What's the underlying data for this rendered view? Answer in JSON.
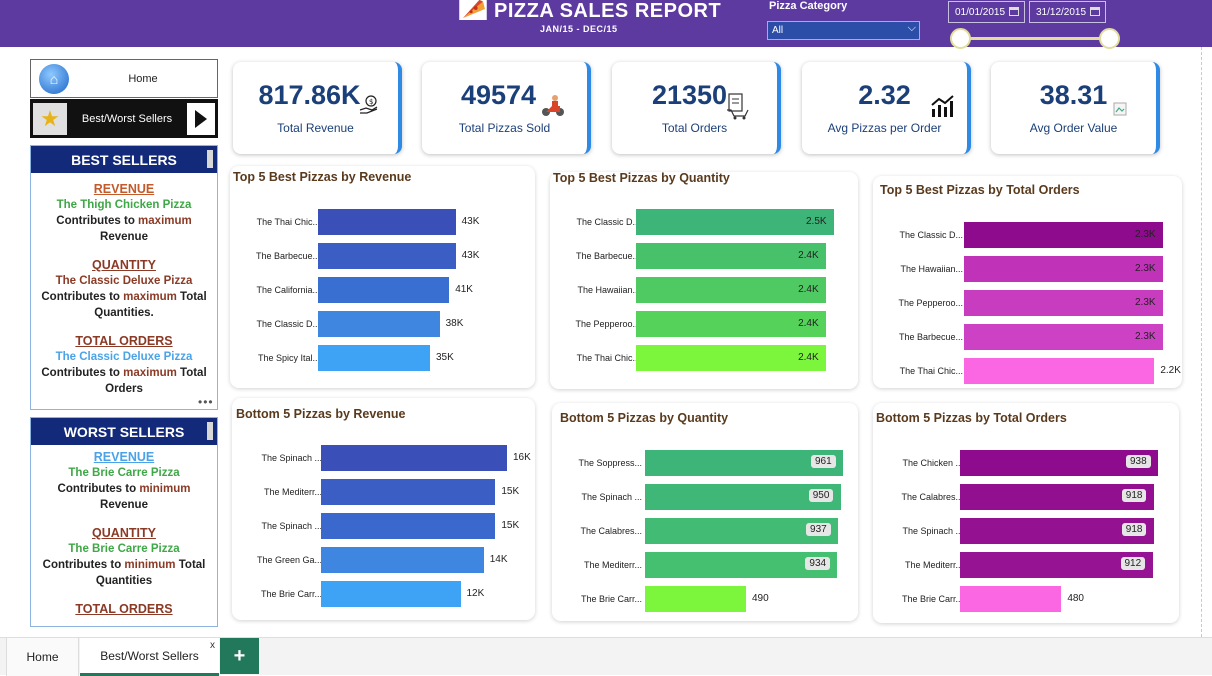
{
  "header": {
    "title": "PIZZA SALES REPORT",
    "subtitle": "JAN/15 - DEC/15",
    "category_label": "Pizza Category",
    "category_value": "All",
    "date_start": "01/01/2015",
    "date_end": "31/12/2015",
    "bg_color": "#5d3aa0"
  },
  "nav": {
    "home_label": "Home",
    "best_worst_label": "Best/Worst Sellers"
  },
  "best_sellers": {
    "heading": "BEST SELLERS",
    "revenue_title": "REVENUE",
    "revenue_pizza": "The Thigh Chicken Pizza",
    "revenue_line1_a": "Contributes to ",
    "revenue_line1_b": "maximum",
    "revenue_line2": "Revenue",
    "quantity_title": "QUANTITY",
    "quantity_pizza": "The Classic Deluxe Pizza",
    "quantity_line1_a": "Contributes to ",
    "quantity_line1_b": "maximum",
    "quantity_line1_c": " Total",
    "quantity_line2": "Quantities.",
    "orders_title": "TOTAL ORDERS",
    "orders_pizza": "The Classic Deluxe Pizza",
    "orders_line1_a": "Contributes to ",
    "orders_line1_b": "maximum",
    "orders_line1_c": " Total",
    "orders_line2": "Orders"
  },
  "worst_sellers": {
    "heading": "WORST SELLERS",
    "revenue_title": "REVENUE",
    "revenue_pizza": "The Brie Carre Pizza",
    "revenue_line1_a": "Contributes to ",
    "revenue_line1_b": "minimum",
    "revenue_line2": "Revenue",
    "quantity_title": "QUANTITY",
    "quantity_pizza": "The Brie Carre Pizza",
    "quantity_line1_a": "Contributes to ",
    "quantity_line1_b": "minimum",
    "quantity_line1_c": " Total",
    "quantity_line2": "Quantities",
    "orders_title": "TOTAL ORDERS"
  },
  "kpis": [
    {
      "value": "817.86K",
      "label": "Total Revenue",
      "icon": "money-hand-icon"
    },
    {
      "value": "49574",
      "label": "Total Pizzas Sold",
      "icon": "delivery-scooter-icon"
    },
    {
      "value": "21350",
      "label": "Total Orders",
      "icon": "receipt-cart-icon"
    },
    {
      "value": "2.32",
      "label": "Avg Pizzas per Order",
      "icon": "growth-chart-icon"
    },
    {
      "value": "38.31",
      "label": "Avg Order Value",
      "icon": "broken-image-icon"
    }
  ],
  "chart_data": [
    {
      "type": "bar",
      "title": "Top 5 Best Pizzas by Revenue",
      "categories": [
        "The Thai Chic...",
        "The Barbecue...",
        "The California...",
        "The Classic D...",
        "The Spicy Ital..."
      ],
      "values": [
        43,
        43,
        41,
        38,
        35
      ],
      "labels": [
        "43K",
        "43K",
        "41K",
        "38K",
        "35K"
      ],
      "colors": [
        "#3a4fb8",
        "#3a5ec4",
        "#3a6fd2",
        "#3f86e0",
        "#3ea2f5"
      ],
      "xlim": [
        0,
        55
      ]
    },
    {
      "type": "bar",
      "title": "Top 5 Best Pizzas by Quantity",
      "categories": [
        "The Classic D...",
        "The Barbecue...",
        "The Hawaiian...",
        "The Pepperoo...",
        "The Thai Chic..."
      ],
      "values": [
        2.5,
        2.4,
        2.4,
        2.4,
        2.4
      ],
      "labels": [
        "2.5K",
        "2.4K",
        "2.4K",
        "2.4K",
        "2.4K"
      ],
      "colors": [
        "#3db478",
        "#48c26a",
        "#4fca62",
        "#55d25a",
        "#7cf53d"
      ],
      "xlim": [
        0,
        2.5
      ]
    },
    {
      "type": "bar",
      "title": "Top 5 Best Pizzas by Total Orders",
      "categories": [
        "The Classic D...",
        "The Hawaiian...",
        "The Pepperoo...",
        "The Barbecue...",
        "The Thai Chic..."
      ],
      "values": [
        2.3,
        2.3,
        2.3,
        2.3,
        2.2
      ],
      "labels": [
        "2.3K",
        "2.3K",
        "2.3K",
        "2.3K",
        "2.2K"
      ],
      "colors": [
        "#8e0b8e",
        "#c032b8",
        "#c83cbf",
        "#cd42c4",
        "#fb66e2"
      ],
      "xlim": [
        0,
        2.3
      ]
    },
    {
      "type": "bar",
      "title": "Bottom 5 Pizzas by Revenue",
      "categories": [
        "The Spinach ...",
        "The Mediterr...",
        "The Spinach ...",
        "The Green Ga...",
        "The Brie Carr..."
      ],
      "values": [
        16,
        15,
        15,
        14,
        12
      ],
      "labels": [
        "16K",
        "15K",
        "15K",
        "14K",
        "12K"
      ],
      "colors": [
        "#3a4fb8",
        "#3a5ec4",
        "#3a68cd",
        "#3f86e0",
        "#3ea2f5"
      ],
      "xlim": [
        0,
        16
      ]
    },
    {
      "type": "bar",
      "title": "Bottom 5 Pizzas by Quantity",
      "categories": [
        "The Soppress...",
        "The Spinach ...",
        "The Calabres...",
        "The Mediterr...",
        "The Brie Carr..."
      ],
      "values": [
        961,
        950,
        937,
        934,
        490
      ],
      "labels": [
        "961",
        "950",
        "937",
        "934",
        "490"
      ],
      "colors": [
        "#3db478",
        "#3fb877",
        "#42bc74",
        "#45c070",
        "#7cf53d"
      ],
      "xlim": [
        0,
        961
      ]
    },
    {
      "type": "bar",
      "title": "Bottom 5 Pizzas by Total Orders",
      "categories": [
        "The Chicken ...",
        "The Calabres...",
        "The Spinach ...",
        "The Mediterr...",
        "The Brie Carr..."
      ],
      "values": [
        938,
        918,
        918,
        912,
        480
      ],
      "labels": [
        "938",
        "918",
        "918",
        "912",
        "480"
      ],
      "colors": [
        "#8e0b8e",
        "#920f90",
        "#941192",
        "#961394",
        "#fb66e2"
      ],
      "xlim": [
        0,
        938
      ]
    }
  ],
  "tabs": {
    "home": "Home",
    "active": "Best/Worst Sellers",
    "close": "x",
    "add": "+"
  }
}
